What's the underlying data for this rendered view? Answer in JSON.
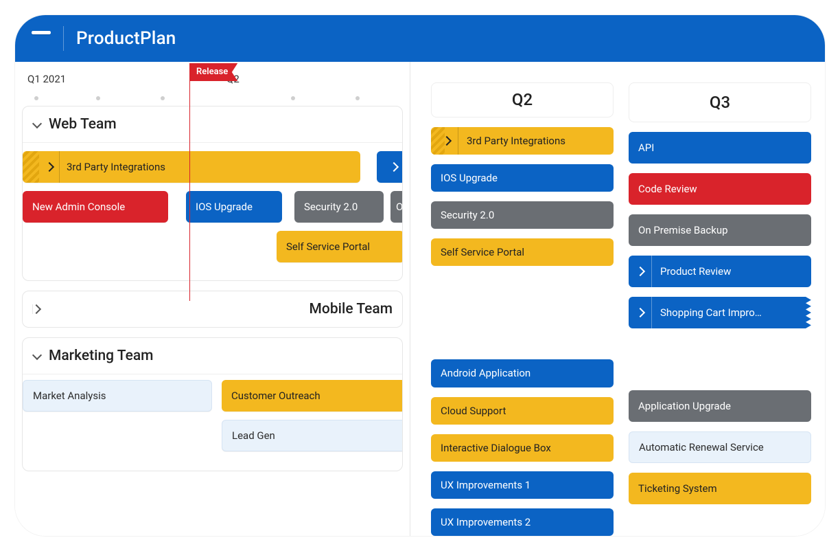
{
  "app": {
    "name": "ProductPlan"
  },
  "timeline": {
    "q1": "Q1 2021",
    "q2_ghost": "Q2",
    "release_label": "Release",
    "lanes": {
      "web": {
        "title": "Web Team",
        "bars": {
          "third_party": "3rd Party Integrations",
          "new_admin": "New Admin Console",
          "ios": "IOS Upgrade",
          "security": "Security 2.0",
          "onprem": "On",
          "self_service": "Self Service Portal"
        }
      },
      "mobile": {
        "title": "Mobile Team"
      },
      "marketing": {
        "title": "Marketing Team",
        "bars": {
          "analysis": "Market Analysis",
          "outreach": "Customer Outreach",
          "leadgen": "Lead Gen"
        }
      }
    }
  },
  "board": {
    "columns": [
      {
        "title": "Q2",
        "groups": [
          [
            {
              "label": "3rd Party Integrations",
              "style": "yellow",
              "expand": true,
              "stripe": true
            },
            {
              "label": "IOS Upgrade",
              "style": "blue"
            },
            {
              "label": "Security 2.0",
              "style": "gray"
            },
            {
              "label": "Self Service Portal",
              "style": "yellow"
            }
          ],
          [
            {
              "label": "Android Application",
              "style": "blue"
            },
            {
              "label": "Cloud Support",
              "style": "yellow"
            },
            {
              "label": "Interactive Dialogue Box",
              "style": "yellow"
            },
            {
              "label": "UX Improvements 1",
              "style": "blue"
            },
            {
              "label": "UX Improvements 2",
              "style": "blue"
            }
          ]
        ]
      },
      {
        "title": "Q3",
        "groups": [
          [
            {
              "label": "API",
              "style": "blue"
            },
            {
              "label": "Code Review",
              "style": "red"
            },
            {
              "label": "On Premise Backup",
              "style": "gray"
            },
            {
              "label": "Product Review",
              "style": "blue",
              "expand": true
            },
            {
              "label": "Shopping Cart Impro…",
              "style": "blue",
              "expand": true,
              "zig": true
            }
          ],
          [
            {
              "label": "Application Upgrade",
              "style": "gray"
            },
            {
              "label": "Automatic Renewal Service",
              "style": "lblue"
            },
            {
              "label": "Ticketing System",
              "style": "yellow"
            }
          ]
        ]
      }
    ]
  }
}
